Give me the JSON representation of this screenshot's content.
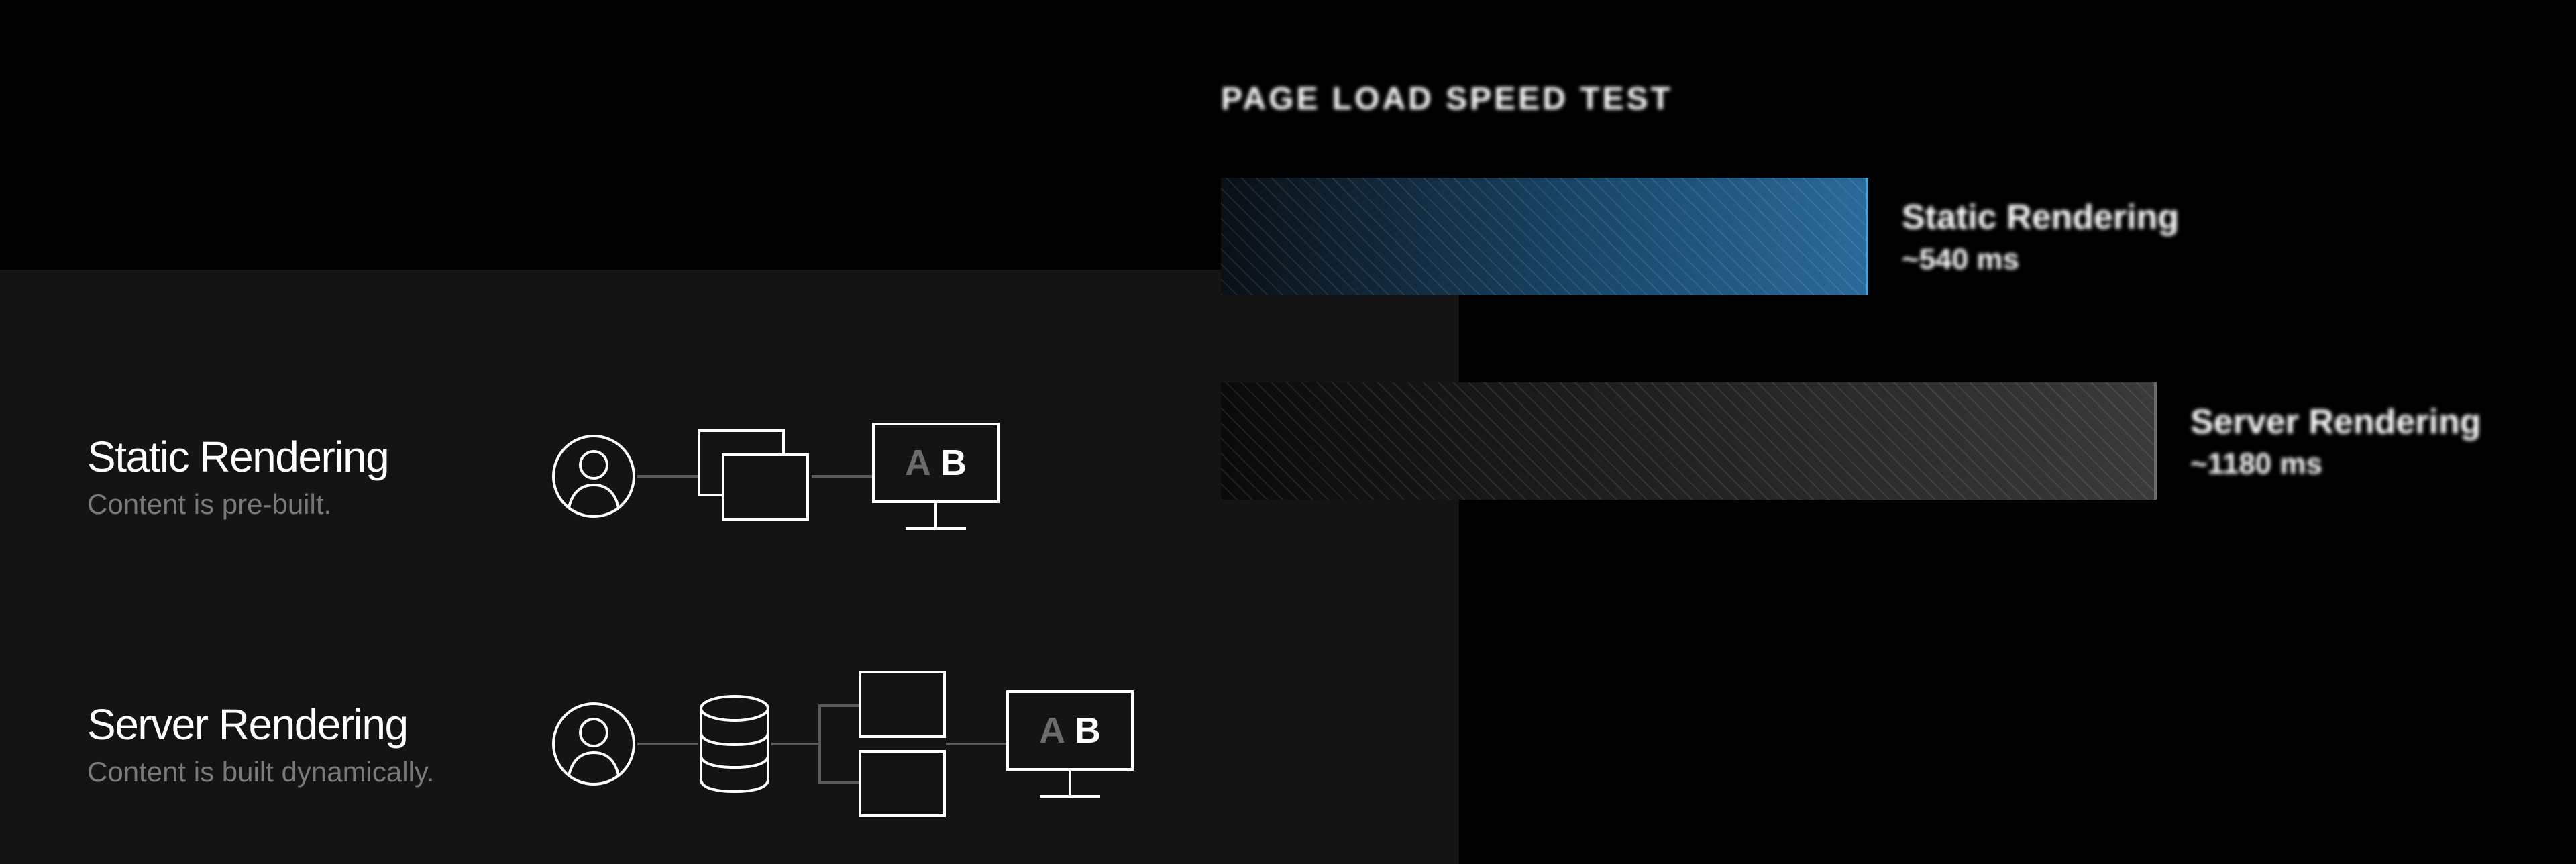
{
  "left_card": {
    "static": {
      "title": "Static Rendering",
      "subtitle": "Content is pre-built.",
      "monitor_letter_a": "A",
      "monitor_letter_b": "B"
    },
    "server": {
      "title": "Server Rendering",
      "subtitle": "Content is built dynamically.",
      "monitor_letter_a": "A",
      "monitor_letter_b": "B"
    }
  },
  "chart": {
    "title": "PAGE LOAD SPEED TEST",
    "bars": {
      "static": {
        "label": "Static Rendering",
        "value": "~540 ms"
      },
      "server": {
        "label": "Server Rendering",
        "value": "~1180 ms"
      }
    }
  },
  "chart_data": {
    "type": "bar",
    "title": "PAGE LOAD SPEED TEST",
    "categories": [
      "Static Rendering",
      "Server Rendering"
    ],
    "values": [
      540,
      1180
    ],
    "unit": "ms",
    "xlabel": "",
    "ylabel": "",
    "ylim": [
      0,
      1200
    ]
  },
  "colors": {
    "bg": "#000000",
    "card_bg": "#141414",
    "text_primary": "#ffffff",
    "text_muted": "#7a7a7a",
    "bar_static": "#2b6a99",
    "bar_server": "#3a3a3a"
  }
}
